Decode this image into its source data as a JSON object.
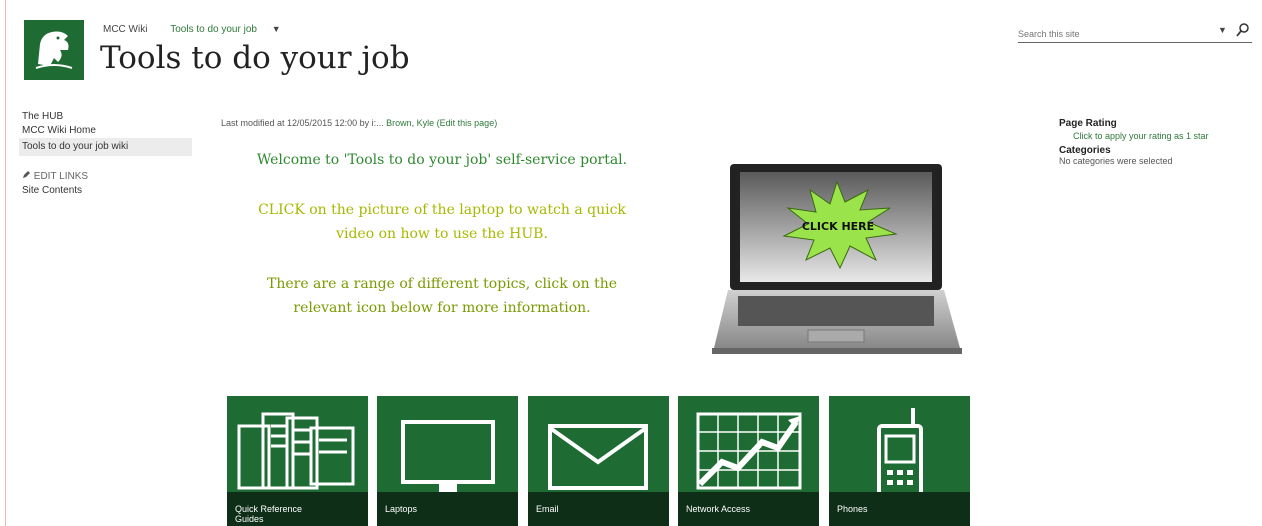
{
  "site": {
    "breadcrumb_root": "MCC Wiki",
    "breadcrumb_current": "Tools to do your job",
    "breadcrumb_arrow": "▼",
    "page_title": "Tools to do your job"
  },
  "search": {
    "placeholder": "Search this site",
    "dropdown": "▼"
  },
  "left_nav": {
    "items": [
      {
        "label": "The HUB"
      },
      {
        "label": "MCC Wiki Home"
      },
      {
        "label": "Tools to do your job wiki"
      }
    ],
    "edit_links": "EDIT LINKS",
    "site_contents": "Site Contents"
  },
  "content": {
    "modified_prefix": "Last modified at 12/05/2015 12:00 by i:...",
    "modified_user": "Brown, Kyle (Edit this page)",
    "welcome": "Welcome to 'Tools to do your job' self-service portal.",
    "click_line1": "CLICK on the picture of the laptop to watch a quick",
    "click_line2": "video on how to use the HUB.",
    "topics_line1": "There are a range of different topics, click on the",
    "topics_line2": "relevant icon below for more information.",
    "laptop_burst": "CLICK HERE"
  },
  "right_panel": {
    "rating_heading": "Page Rating",
    "rating_link": "Click to apply your rating as 1 star",
    "categories_heading": "Categories",
    "categories_text": "No categories were selected"
  },
  "tiles": [
    {
      "label_line1": "Quick Reference",
      "label_line2": "Guides",
      "icon": "documents-icon"
    },
    {
      "label_line1": "Laptops",
      "label_line2": "",
      "icon": "monitor-icon"
    },
    {
      "label_line1": "Email",
      "label_line2": "",
      "icon": "envelope-icon"
    },
    {
      "label_line1": "Network Access",
      "label_line2": "",
      "icon": "chart-icon"
    },
    {
      "label_line1": "Phones",
      "label_line2": "",
      "icon": "phone-icon"
    }
  ],
  "colors": {
    "brand_green": "#1e6b34",
    "tile_band": "#0e2e17",
    "welcome_text": "#2f8a2f",
    "click_text": "#a7b800",
    "topics_text": "#7a9a00",
    "burst": "#9be34a"
  }
}
